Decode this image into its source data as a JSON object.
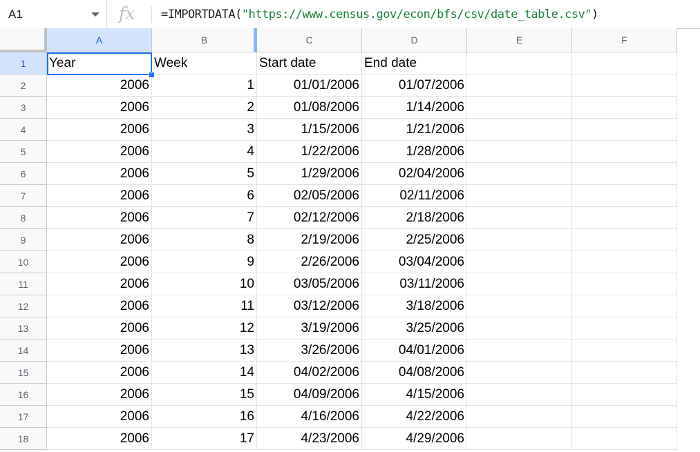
{
  "name_box": {
    "ref": "A1"
  },
  "formula_bar": {
    "fx_label": "fx",
    "prefix": "=IMPORTDATA(",
    "url_string": "\"https://www.census.gov/econ/bfs/csv/date_table.csv\"",
    "suffix": ")"
  },
  "columns": [
    "A",
    "B",
    "C",
    "D",
    "E",
    "F"
  ],
  "header_row": {
    "row_num": "1",
    "cells": [
      "Year",
      "Week",
      "Start date",
      "End date",
      "",
      ""
    ]
  },
  "rows": [
    {
      "row_num": "2",
      "cells": [
        "2006",
        "1",
        "01/01/2006",
        "01/07/2006",
        "",
        ""
      ]
    },
    {
      "row_num": "3",
      "cells": [
        "2006",
        "2",
        "01/08/2006",
        "1/14/2006",
        "",
        ""
      ]
    },
    {
      "row_num": "4",
      "cells": [
        "2006",
        "3",
        "1/15/2006",
        "1/21/2006",
        "",
        ""
      ]
    },
    {
      "row_num": "5",
      "cells": [
        "2006",
        "4",
        "1/22/2006",
        "1/28/2006",
        "",
        ""
      ]
    },
    {
      "row_num": "6",
      "cells": [
        "2006",
        "5",
        "1/29/2006",
        "02/04/2006",
        "",
        ""
      ]
    },
    {
      "row_num": "7",
      "cells": [
        "2006",
        "6",
        "02/05/2006",
        "02/11/2006",
        "",
        ""
      ]
    },
    {
      "row_num": "8",
      "cells": [
        "2006",
        "7",
        "02/12/2006",
        "2/18/2006",
        "",
        ""
      ]
    },
    {
      "row_num": "9",
      "cells": [
        "2006",
        "8",
        "2/19/2006",
        "2/25/2006",
        "",
        ""
      ]
    },
    {
      "row_num": "10",
      "cells": [
        "2006",
        "9",
        "2/26/2006",
        "03/04/2006",
        "",
        ""
      ]
    },
    {
      "row_num": "11",
      "cells": [
        "2006",
        "10",
        "03/05/2006",
        "03/11/2006",
        "",
        ""
      ]
    },
    {
      "row_num": "12",
      "cells": [
        "2006",
        "11",
        "03/12/2006",
        "3/18/2006",
        "",
        ""
      ]
    },
    {
      "row_num": "13",
      "cells": [
        "2006",
        "12",
        "3/19/2006",
        "3/25/2006",
        "",
        ""
      ]
    },
    {
      "row_num": "14",
      "cells": [
        "2006",
        "13",
        "3/26/2006",
        "04/01/2006",
        "",
        ""
      ]
    },
    {
      "row_num": "15",
      "cells": [
        "2006",
        "14",
        "04/02/2006",
        "04/08/2006",
        "",
        ""
      ]
    },
    {
      "row_num": "16",
      "cells": [
        "2006",
        "15",
        "04/09/2006",
        "4/15/2006",
        "",
        ""
      ]
    },
    {
      "row_num": "17",
      "cells": [
        "2006",
        "16",
        "4/16/2006",
        "4/22/2006",
        "",
        ""
      ]
    },
    {
      "row_num": "18",
      "cells": [
        "2006",
        "17",
        "4/23/2006",
        "4/29/2006",
        "",
        ""
      ]
    }
  ],
  "colors": {
    "selection": "#1a73e8",
    "header_active_bg": "#d3e3fd",
    "formula_string": "#188038"
  }
}
